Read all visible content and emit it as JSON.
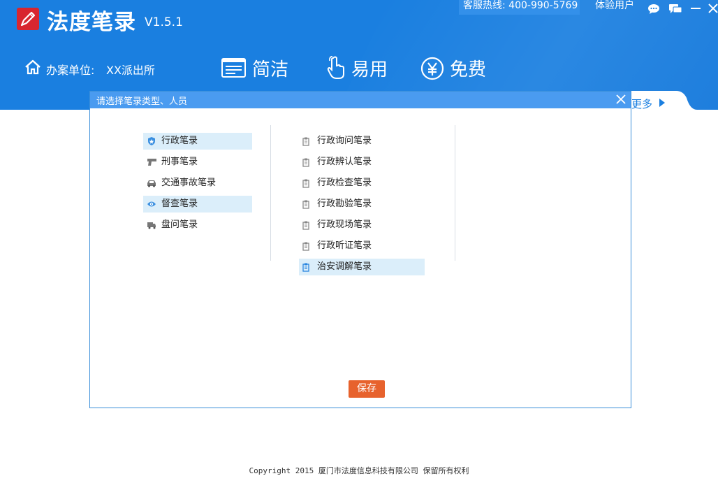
{
  "app": {
    "name": "法度笔录",
    "version": "V1.5.1",
    "hotline": "客服热线:  400-990-5769",
    "user": "体验用户"
  },
  "unit": {
    "label": "办案单位:",
    "value": "XX派出所"
  },
  "features": [
    {
      "icon": "document-lines-icon",
      "label": "简洁"
    },
    {
      "icon": "pointing-hand-icon",
      "label": "易用"
    },
    {
      "icon": "yen-circle-icon",
      "label": "免费"
    }
  ],
  "more": "更多",
  "dialog": {
    "title": "请选择笔录类型、人员",
    "categories": [
      {
        "icon": "police-badge-icon",
        "label": "行政笔录",
        "selected": true
      },
      {
        "icon": "pistol-icon",
        "label": "刑事笔录",
        "selected": false
      },
      {
        "icon": "car-icon",
        "label": "交通事故笔录",
        "selected": false
      },
      {
        "icon": "eye-icon",
        "label": "督查笔录",
        "selected": true
      },
      {
        "icon": "truck-icon",
        "label": "盘问笔录",
        "selected": false
      }
    ],
    "types": [
      {
        "icon": "clipboard-icon",
        "label": "行政询问笔录",
        "selected": false
      },
      {
        "icon": "clipboard-icon",
        "label": "行政辨认笔录",
        "selected": false
      },
      {
        "icon": "clipboard-icon",
        "label": "行政检查笔录",
        "selected": false
      },
      {
        "icon": "clipboard-icon",
        "label": "行政勘验笔录",
        "selected": false
      },
      {
        "icon": "clipboard-icon",
        "label": "行政现场笔录",
        "selected": false
      },
      {
        "icon": "clipboard-icon",
        "label": "行政听证笔录",
        "selected": false
      },
      {
        "icon": "clipboard-icon",
        "label": "治安调解笔录",
        "selected": true
      }
    ],
    "save_label": "保存"
  },
  "footer": {
    "copyright": "Copyright  2015 厦门市法度信息科技有限公司 保留所有权利"
  },
  "colors": {
    "header": "#1a7fe0",
    "dialog_titlebar": "#4a9bf0",
    "save_button": "#e7622d",
    "selection": "#dbeefa"
  }
}
